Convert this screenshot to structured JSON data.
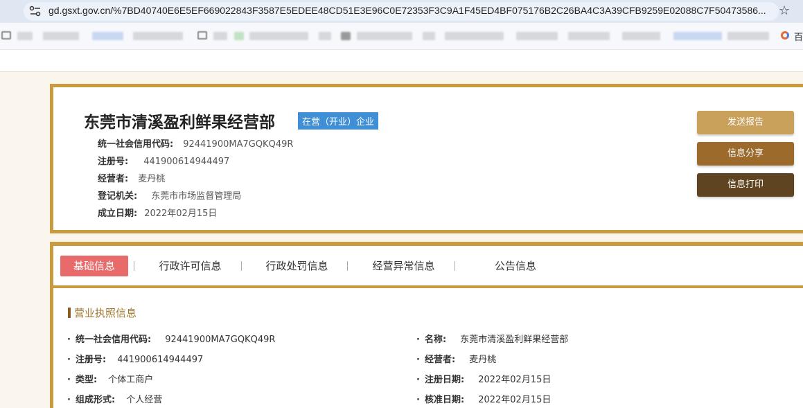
{
  "browser": {
    "url": "gd.gsxt.gov.cn/%7BD40740E6E5EF669022843F3587E5EDEE48CD51E3E96C0E72353F3C9A1F45ED4BF075176B2C26BA4C3A39CFB9259E02088C7F50473586...",
    "bookmark_right_label": "百"
  },
  "header": {
    "company_name": "东莞市清溪盈利鲜果经营部",
    "status_badge": "在营（开业）企业",
    "fields": [
      {
        "label": "统一社会信用代码:",
        "value": "92441900MA7GQKQ49R"
      },
      {
        "label": "注册号:",
        "value": "441900614944497"
      },
      {
        "label": "经营者:",
        "value": "麦丹桃"
      },
      {
        "label": "登记机关:",
        "value": "东莞市市场监督管理局"
      },
      {
        "label": "成立日期:",
        "value": "2022年02月15日"
      }
    ],
    "buttons": [
      {
        "label": "发送报告",
        "color": "#c9a15a"
      },
      {
        "label": "信息分享",
        "color": "#9c6a2a"
      },
      {
        "label": "信息打印",
        "color": "#5e4420"
      }
    ]
  },
  "tabs": [
    "基础信息",
    "行政许可信息",
    "行政处罚信息",
    "经营异常信息",
    "公告信息"
  ],
  "section": {
    "title": "营业执照信息",
    "left": [
      {
        "label": "统一社会信用代码:",
        "value": "92441900MA7GQKQ49R"
      },
      {
        "label": "注册号:",
        "value": "441900614944497"
      },
      {
        "label": "类型:",
        "value": "个体工商户"
      },
      {
        "label": "组成形式:",
        "value": "个人经营"
      }
    ],
    "right": [
      {
        "label": "名称:",
        "value": "东莞市清溪盈利鲜果经营部"
      },
      {
        "label": "经营者:",
        "value": "麦丹桃"
      },
      {
        "label": "注册日期:",
        "value": "2022年02月15日"
      },
      {
        "label": "核准日期:",
        "value": "2022年02月15日"
      }
    ]
  },
  "colors": {
    "accent": "#c99b3e",
    "active_tab": "#e86a6a",
    "badge": "#3e8fd6"
  }
}
